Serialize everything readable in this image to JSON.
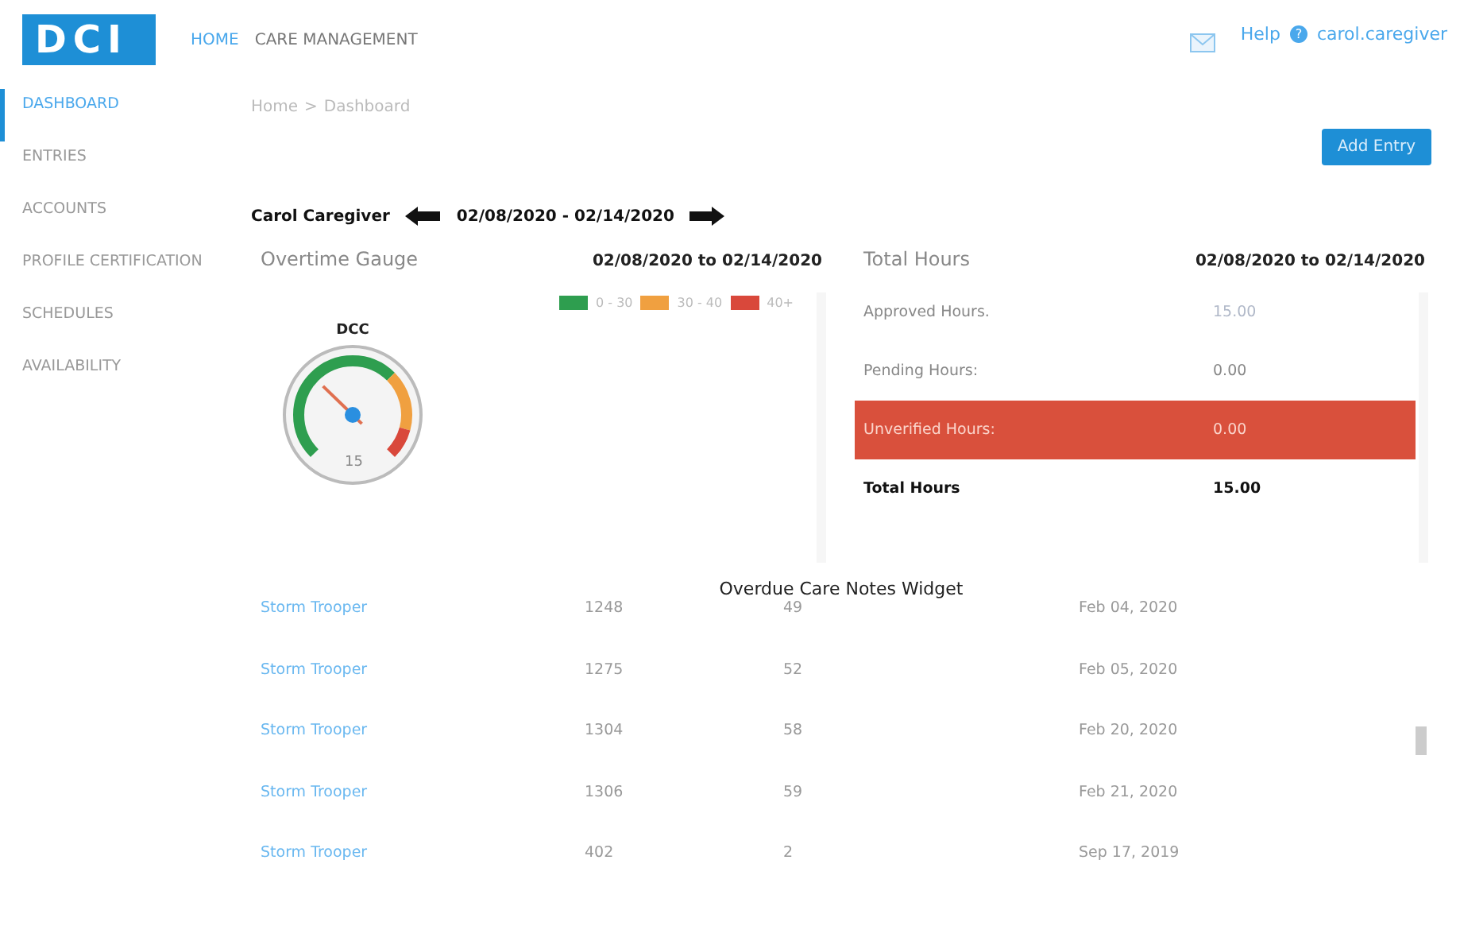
{
  "logo": {
    "text": "DCI"
  },
  "top_nav": [
    {
      "label": "HOME",
      "selected": true
    },
    {
      "label": "CARE MANAGEMENT",
      "selected": false
    }
  ],
  "header_links": {
    "help": "Help",
    "help_mark": "?",
    "user": "carol.caregiver"
  },
  "sidebar": {
    "items": [
      {
        "label": "DASHBOARD",
        "selected": true
      },
      {
        "label": "ENTRIES",
        "selected": false
      },
      {
        "label": "ACCOUNTS",
        "selected": false
      },
      {
        "label": "PROFILE CERTIFICATION",
        "selected": false
      },
      {
        "label": "SCHEDULES",
        "selected": false
      },
      {
        "label": "AVAILABILITY",
        "selected": false
      }
    ]
  },
  "breadcrumb": [
    "Home",
    "Dashboard"
  ],
  "breadcrumb_separator": ">",
  "add_button": "Add Entry",
  "period": {
    "name": "Carol Caregiver",
    "range": "02/08/2020 - 02/14/2020"
  },
  "overtime_gauge": {
    "title": "Overtime Gauge",
    "range": "02/08/2020 to 02/14/2020",
    "legend": [
      {
        "label": "0 - 30",
        "color": "#2e9e4f"
      },
      {
        "label": "30 - 40",
        "color": "#f0a040"
      },
      {
        "label": "40+",
        "color": "#d9483b"
      }
    ],
    "gauge_label": "DCC",
    "value": "15"
  },
  "total_hours": {
    "title": "Total Hours",
    "range": "02/08/2020 to 02/14/2020",
    "rows": [
      {
        "label": "Approved Hours.",
        "value": "15.00",
        "kind": "approved"
      },
      {
        "label": "Pending Hours:",
        "value": "0.00",
        "kind": "plain"
      },
      {
        "label": "Unverified Hours:",
        "value": "0.00",
        "kind": "alert"
      },
      {
        "label": "Total Hours",
        "value": "15.00",
        "kind": "total"
      }
    ]
  },
  "overdue_notes": {
    "title": "Overdue Care Notes Widget",
    "rows": [
      {
        "name": "Storm Trooper",
        "column_2": "1248",
        "column_3": "49",
        "date": "Feb 04, 2020"
      },
      {
        "name": "Storm Trooper",
        "column_2": "1275",
        "column_3": "52",
        "date": "Feb 05, 2020"
      },
      {
        "name": "Storm Trooper",
        "column_2": "1304",
        "column_3": "58",
        "date": "Feb 20, 2020"
      },
      {
        "name": "Storm Trooper",
        "column_2": "1306",
        "column_3": "59",
        "date": "Feb 21, 2020"
      },
      {
        "name": "Storm Trooper",
        "column_2": "402",
        "column_3": "2",
        "date": "Sep 17, 2019"
      }
    ]
  }
}
